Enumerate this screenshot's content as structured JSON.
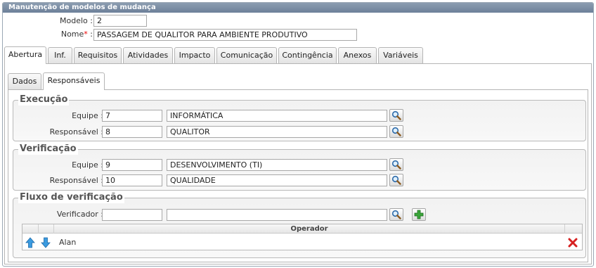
{
  "window": {
    "title": "Manutenção de modelos de mudança"
  },
  "header": {
    "modelo_label": "Modelo :",
    "modelo_value": "2",
    "nome_label": "Nome",
    "nome_required": "*",
    "nome_colon": " :",
    "nome_value": "PASSAGEM DE QUALITOR PARA AMBIENTE PRODUTIVO"
  },
  "main_tabs": [
    {
      "label": "Abertura",
      "active": true
    },
    {
      "label": "Inf.",
      "active": false
    },
    {
      "label": "Requisitos",
      "active": false
    },
    {
      "label": "Atividades",
      "active": false
    },
    {
      "label": "Impacto",
      "active": false
    },
    {
      "label": "Comunicação",
      "active": false
    },
    {
      "label": "Contingência",
      "active": false
    },
    {
      "label": "Anexos",
      "active": false
    },
    {
      "label": "Variáveis",
      "active": false
    }
  ],
  "sub_tabs": [
    {
      "label": "Dados",
      "active": false
    },
    {
      "label": "Responsáveis",
      "active": true
    }
  ],
  "execucao": {
    "legend": "Execução",
    "equipe_label": "Equipe :",
    "equipe_code": "7",
    "equipe_name": "INFORMÁTICA",
    "responsavel_label": "Responsável :",
    "responsavel_code": "8",
    "responsavel_name": "QUALITOR"
  },
  "verificacao": {
    "legend": "Verificação",
    "equipe_label": "Equipe :",
    "equipe_code": "9",
    "equipe_name": "DESENVOLVIMENTO (TI)",
    "responsavel_label": "Responsável :",
    "responsavel_code": "10",
    "responsavel_name": "QUALIDADE"
  },
  "fluxo": {
    "legend": "Fluxo de verificação",
    "verificador_label": "Verificador :",
    "verificador_code": "",
    "verificador_name": "",
    "grid_header": "Operador",
    "rows": [
      {
        "operador": "Alan"
      }
    ]
  },
  "icons": {
    "search": "magnifier-icon",
    "add": "plus-icon",
    "up": "arrow-up-icon",
    "down": "arrow-down-icon",
    "delete": "delete-x-icon"
  },
  "colors": {
    "titlebar": "#7a8ca3",
    "add_green": "#3aa63a",
    "arrow_blue": "#2f8fd8",
    "delete_red": "#d62020"
  }
}
